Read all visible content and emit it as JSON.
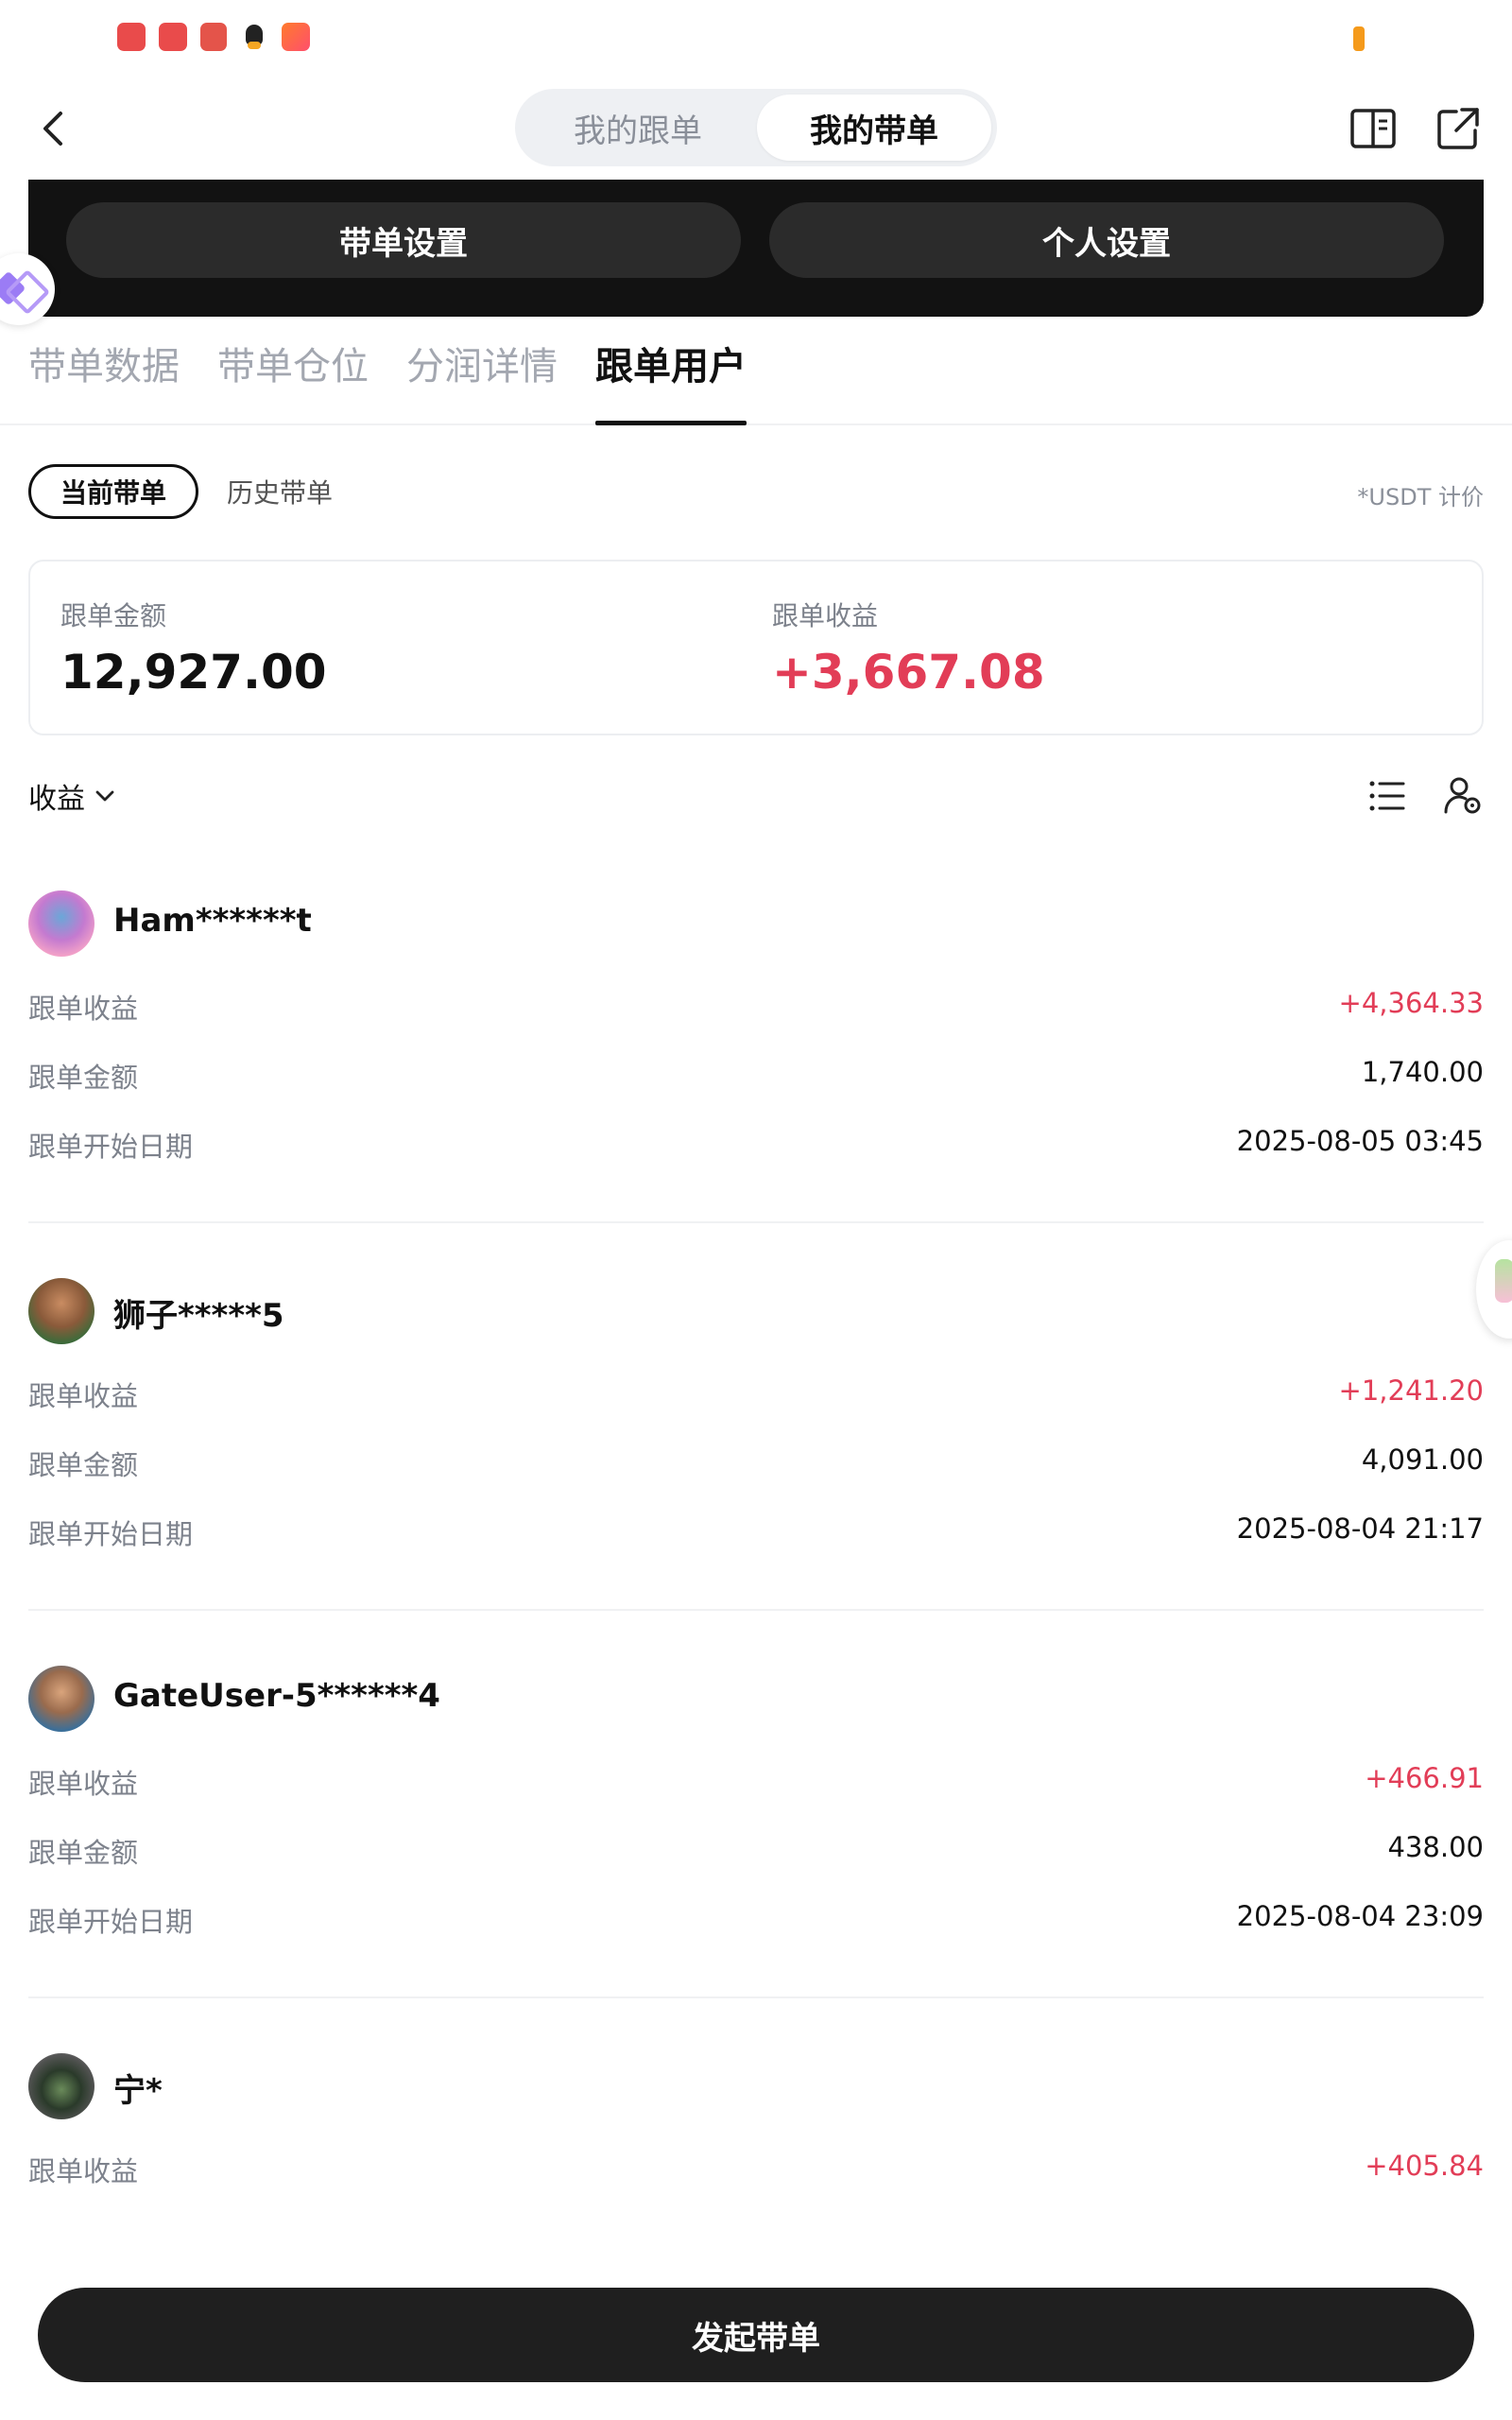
{
  "header": {
    "segment": {
      "left_label": "我的跟单",
      "right_label": "我的带单",
      "selected": "我的带单"
    },
    "icons": [
      "back-icon",
      "book-icon",
      "share-icon"
    ]
  },
  "settings_panel": {
    "left_button": "带单设置",
    "right_button": "个人设置"
  },
  "tabs": [
    {
      "label": "带单数据",
      "active": false
    },
    {
      "label": "带单仓位",
      "active": false
    },
    {
      "label": "分润详情",
      "active": false
    },
    {
      "label": "跟单用户",
      "active": true
    }
  ],
  "sub_tabs": {
    "current": "当前带单",
    "history": "历史带单",
    "note": "*USDT 计价"
  },
  "summary": {
    "amount_label": "跟单金额",
    "amount_value": "12,927.00",
    "profit_label": "跟单收益",
    "profit_value": "+3,667.08"
  },
  "sort": {
    "label": "收益",
    "icons": [
      "list-icon",
      "user-settings-icon"
    ]
  },
  "followers": [
    {
      "name": "Ham******t",
      "profit_label": "跟单收益",
      "profit": "+4,364.33",
      "amount_label": "跟单金额",
      "amount": "1,740.00",
      "date_label": "跟单开始日期",
      "date": "2025-08-05 03:45"
    },
    {
      "name": "狮子*****5",
      "profit_label": "跟单收益",
      "profit": "+1,241.20",
      "amount_label": "跟单金额",
      "amount": "4,091.00",
      "date_label": "跟单开始日期",
      "date": "2025-08-04 21:17"
    },
    {
      "name": "GateUser-5******4",
      "profit_label": "跟单收益",
      "profit": "+466.91",
      "amount_label": "跟单金额",
      "amount": "438.00",
      "date_label": "跟单开始日期",
      "date": "2025-08-04 23:09"
    },
    {
      "name": "宁*",
      "profit_label": "跟单收益",
      "profit": "+405.84"
    }
  ],
  "bottom_button": "发起带单",
  "colors": {
    "positive": "#e23d57",
    "dark": "#121212",
    "muted": "#7d828c"
  }
}
